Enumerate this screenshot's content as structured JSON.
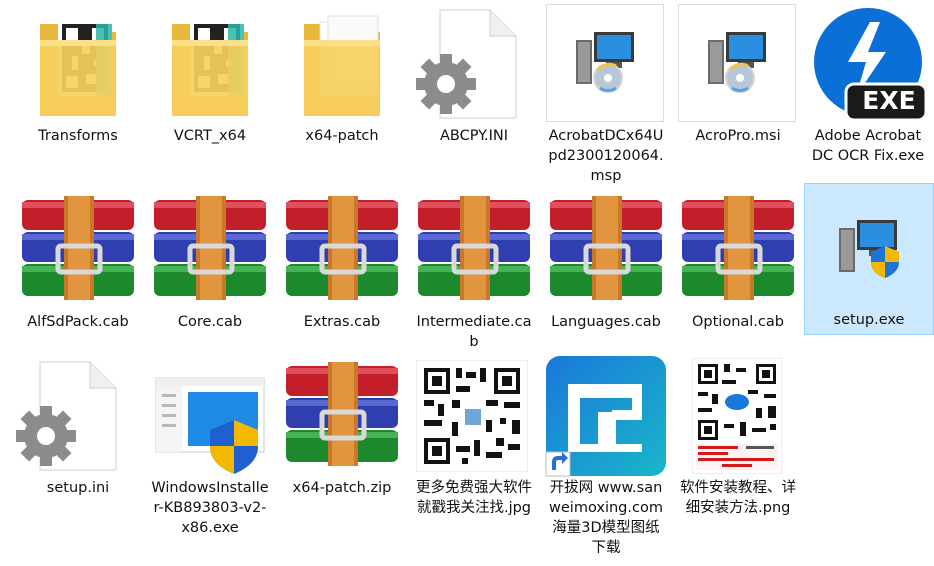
{
  "files": [
    {
      "name": "Transforms",
      "icon": "folder-icon"
    },
    {
      "name": "VCRT_x64",
      "icon": "folder-icon"
    },
    {
      "name": "x64-patch",
      "icon": "folder-icon"
    },
    {
      "name": "ABCPY.INI",
      "icon": "settings-file-icon"
    },
    {
      "name": "AcrobatDCx64Upd2300120064.msp",
      "icon": "installer-icon"
    },
    {
      "name": "AcroPro.msi",
      "icon": "installer-icon"
    },
    {
      "name": "Adobe Acrobat DC OCR Fix.exe",
      "icon": "exe-icon",
      "badge": "EXE"
    },
    {
      "name": "AlfSdPack.cab",
      "icon": "archive-icon"
    },
    {
      "name": "Core.cab",
      "icon": "archive-icon"
    },
    {
      "name": "Extras.cab",
      "icon": "archive-icon"
    },
    {
      "name": "Intermediate.cab",
      "icon": "archive-icon"
    },
    {
      "name": "Languages.cab",
      "icon": "archive-icon"
    },
    {
      "name": "Optional.cab",
      "icon": "archive-icon"
    },
    {
      "name": "setup.exe",
      "icon": "setup-icon",
      "selected": true
    },
    {
      "name": "setup.ini",
      "icon": "settings-file-icon"
    },
    {
      "name": "WindowsInstaller-KB893803-v2-x86.exe",
      "icon": "windows-installer-icon"
    },
    {
      "name": "x64-patch.zip",
      "icon": "archive-icon"
    },
    {
      "name": "更多免费强大软件就戳我关注找.jpg",
      "icon": "qr-image-icon"
    },
    {
      "name": "开拔网 www.sanweimoxing.com海量3D模型图纸下载",
      "icon": "shortcut-app-icon"
    },
    {
      "name": "软件安装教程、详细安装方法.png",
      "icon": "qr-poster-icon"
    }
  ],
  "colors": {
    "selection": "#cce8ff",
    "folder": "#f6d365",
    "archive_red": "#c21f2a",
    "archive_blue": "#2f3fb0",
    "archive_green": "#1c8a2c",
    "exe_blue": "#0a6fd6",
    "app_tile": "#1496d6"
  }
}
